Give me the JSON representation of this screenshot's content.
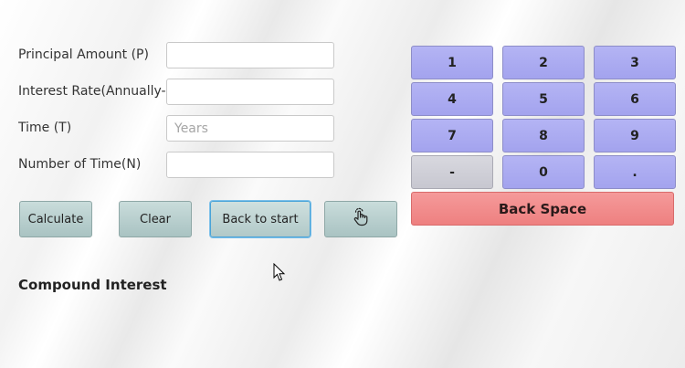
{
  "form": {
    "principal_label": "Principal Amount (P)",
    "principal_value": "",
    "rate_label": "Interest Rate(Annually-R)",
    "rate_value": "",
    "time_label": "Time (T)",
    "time_value": "",
    "time_placeholder": "Years",
    "count_label": "Number of Time(N)",
    "count_value": ""
  },
  "actions": {
    "calculate": "Calculate",
    "clear": "Clear",
    "back_to_start": "Back to start",
    "gesture_icon": "hand-touch-icon"
  },
  "keypad": {
    "keys": [
      "1",
      "2",
      "3",
      "4",
      "5",
      "6",
      "7",
      "8",
      "9",
      "-",
      "0",
      "."
    ],
    "backspace": "Back Space"
  },
  "result": {
    "title": "Compound Interest"
  },
  "colors": {
    "keypad_key": "#aaaaf0",
    "keypad_minus": "#cfcfd7",
    "backspace": "#f08888",
    "action_button": "#b8cfce",
    "focus_ring": "#49a3d8"
  }
}
